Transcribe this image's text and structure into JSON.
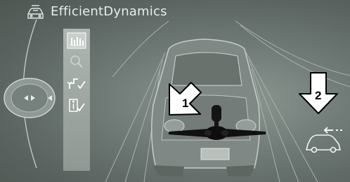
{
  "header": {
    "title": "EfficientDynamics",
    "icon": "car-info-icon"
  },
  "menu": {
    "items": [
      {
        "icon": "bar-graph-icon",
        "state": "active"
      },
      {
        "icon": "magnifier-icon",
        "state": "dimmed"
      },
      {
        "icon": "route-check-icon",
        "state": "normal"
      },
      {
        "icon": "info-check-icon",
        "state": "normal"
      }
    ]
  },
  "controller": {
    "icon": "idrive-controller-icon"
  },
  "callouts": {
    "arrow_1": "1",
    "arrow_2": "2"
  },
  "indicator": {
    "icon": "car-energy-flow-icon"
  },
  "colors": {
    "screen_bg": "#6f7975",
    "menu_bg": "#aeb6b1",
    "callout_fill": "#ffffff",
    "callout_stroke": "#000000"
  }
}
